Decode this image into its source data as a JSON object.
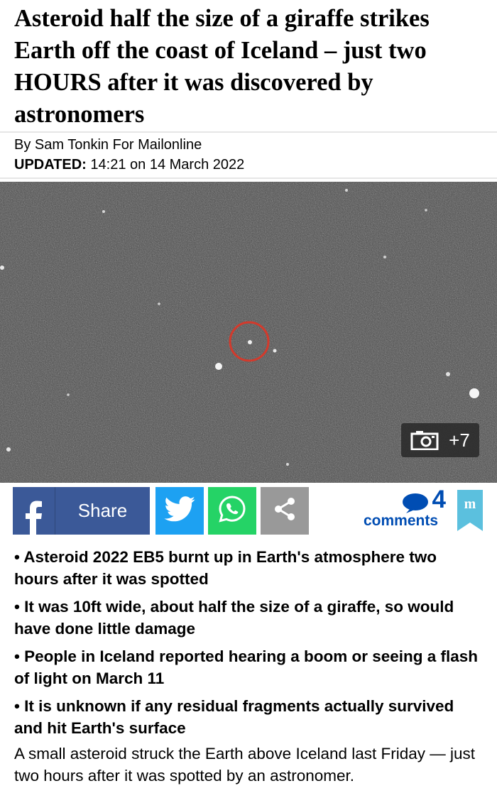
{
  "article": {
    "headline": "Asteroid half the size of a giraffe strikes Earth off the coast of Iceland – just two HOURS after it was discovered by astronomers",
    "byline": "By Sam Tonkin For Mailonline",
    "updated_label": "UPDATED:",
    "updated_value": "14:21 on 14 March 2022",
    "bullets": [
      "• Asteroid 2022 EB5 burnt up in Earth's atmosphere two hours after it was spotted",
      "• It was 10ft wide, about half the size of a giraffe, so would have done little damage",
      "• People in Iceland reported hearing a boom or seeing a flash of light on March 11",
      "• It is unknown if any residual fragments actually survived and hit Earth's surface"
    ],
    "body": "A small asteroid struck the Earth above Iceland last Friday — just two hours after it was spotted by an astronomer."
  },
  "gallery": {
    "extra_count": "+7",
    "icon": "camera-icon"
  },
  "share": {
    "facebook_label": "Share",
    "icons": [
      "facebook-icon",
      "twitter-icon",
      "whatsapp-icon",
      "share-icon"
    ]
  },
  "comments": {
    "count": "4",
    "label": "comments"
  },
  "colors": {
    "facebook": "#3b5998",
    "twitter": "#1da1f2",
    "whatsapp": "#25d366",
    "share": "#999999",
    "comments": "#004db3",
    "dm_badge": "#5bc0de"
  }
}
